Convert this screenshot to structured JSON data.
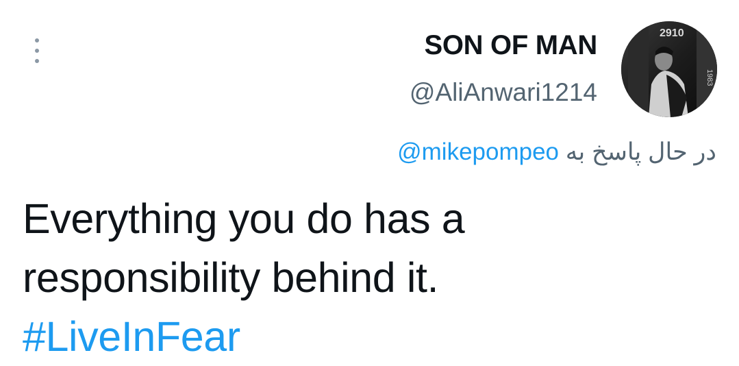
{
  "tweet": {
    "display_name": "SON OF MAN",
    "handle": "@AliAnwari1214",
    "reply_prefix": "در حال پاسخ به",
    "reply_mention": "@mikepompeo",
    "body_line_1": "Everything you do has a",
    "body_line_2": "responsibility behind it.",
    "hashtag": "#LiveInFear"
  },
  "avatar": {
    "overlay_text_top": "2910",
    "overlay_text_side": "1983"
  },
  "colors": {
    "link": "#1d9bf0",
    "secondary_text": "#536471",
    "primary_text": "#0f1419"
  },
  "icons": {
    "more": "more-vertical-icon"
  }
}
